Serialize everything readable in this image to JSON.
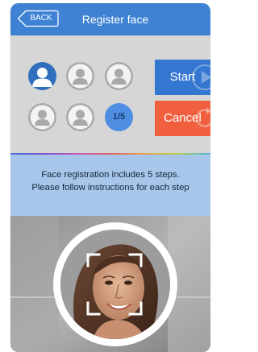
{
  "header": {
    "back_label": "BACK",
    "title": "Register face"
  },
  "steps": {
    "count_label": "1/5",
    "icons": [
      "person-icon-active",
      "person-icon",
      "person-icon",
      "person-icon",
      "person-icon"
    ]
  },
  "actions": {
    "start_label": "Start",
    "cancel_label": "Cancel"
  },
  "info": {
    "line1": "Face registration includes 5 steps.",
    "line2": "Please follow instructions for each step"
  },
  "colors": {
    "header": "#3f82d3",
    "start": "#3477d0",
    "cancel": "#f0603e",
    "info_band": "#a7c6ea"
  }
}
